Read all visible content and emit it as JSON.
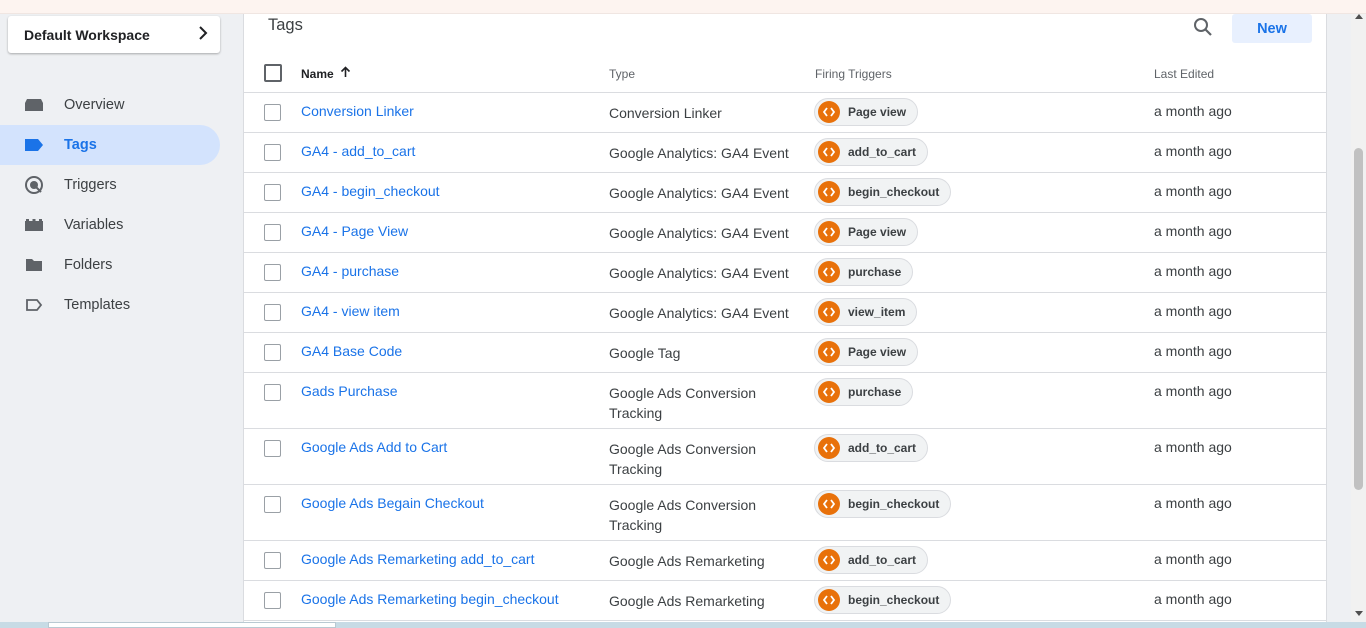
{
  "workspace": {
    "label": "Default Workspace"
  },
  "nav": [
    {
      "label": "Overview",
      "icon": "overview-icon",
      "active": false
    },
    {
      "label": "Tags",
      "icon": "tag-icon",
      "active": true
    },
    {
      "label": "Triggers",
      "icon": "trigger-icon",
      "active": false
    },
    {
      "label": "Variables",
      "icon": "variables-icon",
      "active": false
    },
    {
      "label": "Folders",
      "icon": "folder-icon",
      "active": false
    },
    {
      "label": "Templates",
      "icon": "template-icon",
      "active": false
    }
  ],
  "main": {
    "title": "Tags",
    "new_label": "New",
    "columns": {
      "name": "Name",
      "type": "Type",
      "triggers": "Firing Triggers",
      "edited": "Last Edited"
    }
  },
  "colors": {
    "accent": "#1a73e8",
    "active_nav_bg": "#d3e3fd",
    "trigger_icon": "#e8710a"
  },
  "rows": [
    {
      "name": "Conversion Linker",
      "type": "Conversion Linker",
      "trigger": "Page view",
      "edited": "a month ago"
    },
    {
      "name": "GA4 - add_to_cart",
      "type": "Google Analytics: GA4 Event",
      "trigger": "add_to_cart",
      "edited": "a month ago"
    },
    {
      "name": "GA4 - begin_checkout",
      "type": "Google Analytics: GA4 Event",
      "trigger": "begin_checkout",
      "edited": "a month ago"
    },
    {
      "name": "GA4 - Page View",
      "type": "Google Analytics: GA4 Event",
      "trigger": "Page view",
      "edited": "a month ago"
    },
    {
      "name": "GA4 - purchase",
      "type": "Google Analytics: GA4 Event",
      "trigger": "purchase",
      "edited": "a month ago"
    },
    {
      "name": "GA4 - view item",
      "type": "Google Analytics: GA4 Event",
      "trigger": "view_item",
      "edited": "a month ago"
    },
    {
      "name": "GA4 Base Code",
      "type": "Google Tag",
      "trigger": "Page view",
      "edited": "a month ago"
    },
    {
      "name": "Gads Purchase",
      "type": "Google Ads Conversion Tracking",
      "trigger": "purchase",
      "edited": "a month ago"
    },
    {
      "name": "Google Ads Add to Cart",
      "type": "Google Ads Conversion Tracking",
      "trigger": "add_to_cart",
      "edited": "a month ago"
    },
    {
      "name": "Google Ads Begain Checkout",
      "type": "Google Ads Conversion Tracking",
      "trigger": "begin_checkout",
      "edited": "a month ago"
    },
    {
      "name": "Google Ads Remarketing add_to_cart",
      "type": "Google Ads Remarketing",
      "trigger": "add_to_cart",
      "edited": "a month ago"
    },
    {
      "name": "Google Ads Remarketing begin_checkout",
      "type": "Google Ads Remarketing",
      "trigger": "begin_checkout",
      "edited": "a month ago"
    }
  ]
}
